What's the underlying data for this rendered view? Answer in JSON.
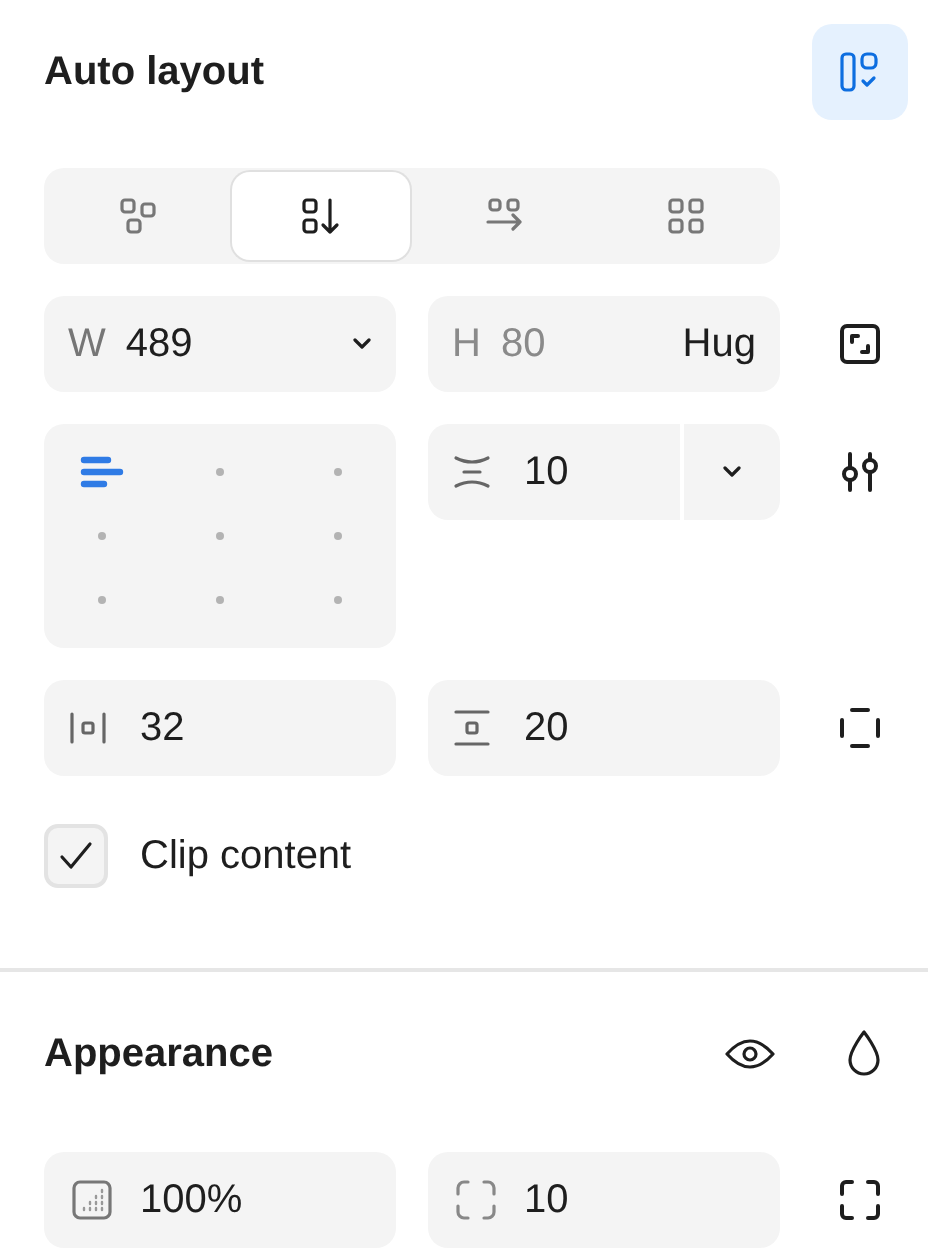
{
  "auto_layout": {
    "title": "Auto layout",
    "enabled": true,
    "directions": [
      {
        "kind": "freeform",
        "selected": false
      },
      {
        "kind": "vertical",
        "selected": true
      },
      {
        "kind": "horizontal",
        "selected": false
      },
      {
        "kind": "wrap",
        "selected": false
      }
    ],
    "width": {
      "label": "W",
      "value": "489"
    },
    "height": {
      "label": "H",
      "value": "80",
      "mode": "Hug"
    },
    "alignment": [
      {
        "selected": true
      },
      {
        "selected": false
      },
      {
        "selected": false
      },
      {
        "selected": false
      },
      {
        "selected": false
      },
      {
        "selected": false
      },
      {
        "selected": false
      },
      {
        "selected": false
      },
      {
        "selected": false
      }
    ],
    "gap": {
      "value": "10"
    },
    "padding_horizontal": {
      "value": "32"
    },
    "padding_vertical": {
      "value": "20"
    },
    "clip_content": {
      "label": "Clip content",
      "checked": true
    }
  },
  "appearance": {
    "title": "Appearance",
    "opacity": {
      "value": "100%"
    },
    "corner_radius": {
      "value": "10"
    }
  }
}
